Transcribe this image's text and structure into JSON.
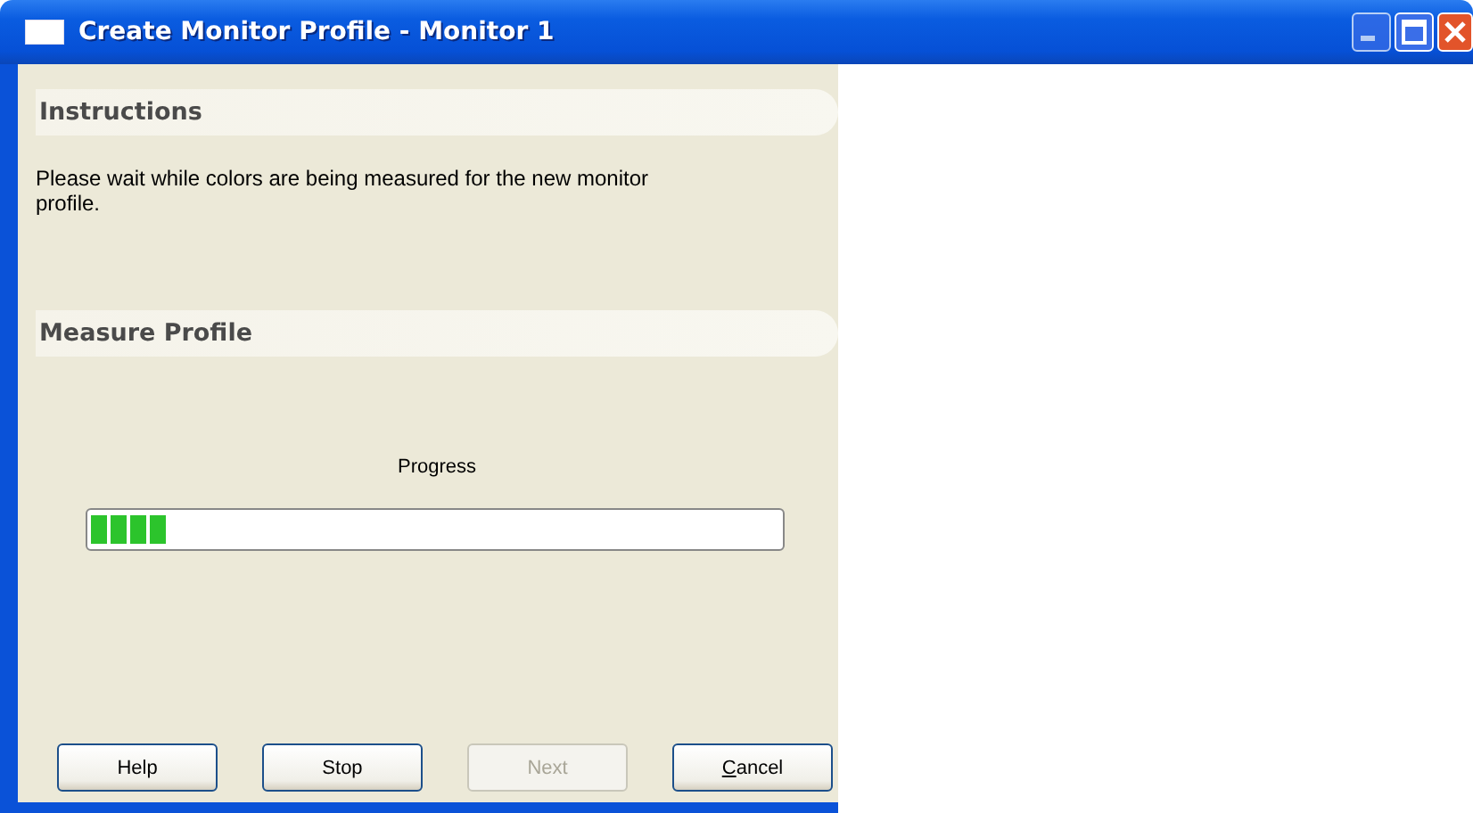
{
  "window": {
    "title": "Create Monitor Profile - Monitor 1"
  },
  "sections": [
    {
      "heading": "Instructions",
      "text": "Please wait while colors are being measured for the new monitor profile."
    },
    {
      "heading": "Measure Profile"
    }
  ],
  "progress": {
    "label": "Progress",
    "level": 0.11
  },
  "buttons": [
    {
      "label": "Help",
      "disabled": false,
      "first_letter_underlined": false
    },
    {
      "label": "Stop",
      "disabled": false,
      "first_letter_underlined": false
    },
    {
      "label": "Next",
      "disabled": true,
      "first_letter_underlined": false
    },
    {
      "label": "Cancel",
      "disabled": false,
      "first_letter_underlined": true
    }
  ]
}
